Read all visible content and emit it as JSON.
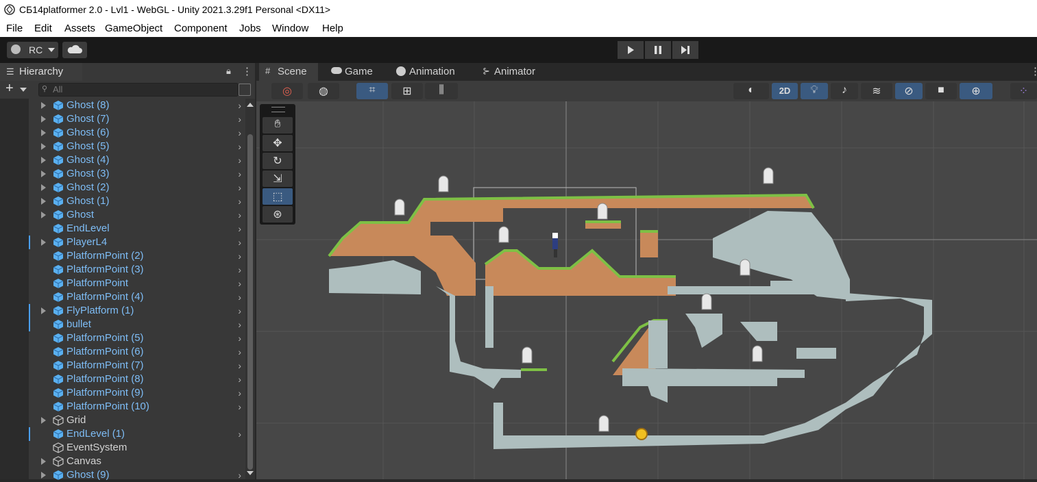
{
  "window": {
    "title": "СБ14platformer 2.0 - Lvl1 - WebGL - Unity 2021.3.29f1 Personal <DX11>"
  },
  "menu": [
    "File",
    "Edit",
    "Assets",
    "GameObject",
    "Component",
    "Jobs",
    "Window",
    "Help"
  ],
  "toolbar": {
    "account_label": "RC",
    "cloud_icon": "cloud-icon",
    "play_icon": "play-icon",
    "pause_icon": "pause-icon",
    "step_icon": "step-icon"
  },
  "hierarchy": {
    "tab_label": "Hierarchy",
    "search_placeholder": "All",
    "items": [
      {
        "label": "Ghost (8)",
        "type": "prefab",
        "expand": true,
        "marker": false
      },
      {
        "label": "Ghost (7)",
        "type": "prefab",
        "expand": true,
        "marker": false
      },
      {
        "label": "Ghost (6)",
        "type": "prefab",
        "expand": true,
        "marker": false
      },
      {
        "label": "Ghost (5)",
        "type": "prefab",
        "expand": true,
        "marker": false
      },
      {
        "label": "Ghost (4)",
        "type": "prefab",
        "expand": true,
        "marker": false
      },
      {
        "label": "Ghost (3)",
        "type": "prefab",
        "expand": true,
        "marker": false
      },
      {
        "label": "Ghost (2)",
        "type": "prefab",
        "expand": true,
        "marker": false
      },
      {
        "label": "Ghost (1)",
        "type": "prefab",
        "expand": true,
        "marker": false
      },
      {
        "label": "Ghost",
        "type": "prefab",
        "expand": true,
        "marker": false
      },
      {
        "label": "EndLevel",
        "type": "prefab",
        "expand": false,
        "marker": false
      },
      {
        "label": "PlayerL4",
        "type": "prefab",
        "expand": true,
        "marker": true
      },
      {
        "label": "PlatformPoint (2)",
        "type": "prefab",
        "expand": false,
        "marker": false
      },
      {
        "label": "PlatformPoint (3)",
        "type": "prefab",
        "expand": false,
        "marker": false
      },
      {
        "label": "PlatformPoint",
        "type": "prefab",
        "expand": false,
        "marker": false
      },
      {
        "label": "PlatformPoint (4)",
        "type": "prefab",
        "expand": false,
        "marker": false
      },
      {
        "label": "FlyPlatform (1)",
        "type": "prefab",
        "expand": true,
        "marker": true
      },
      {
        "label": "bullet",
        "type": "prefab",
        "expand": false,
        "marker": true
      },
      {
        "label": "PlatformPoint (5)",
        "type": "prefab",
        "expand": false,
        "marker": false
      },
      {
        "label": "PlatformPoint (6)",
        "type": "prefab",
        "expand": false,
        "marker": false
      },
      {
        "label": "PlatformPoint (7)",
        "type": "prefab",
        "expand": false,
        "marker": false
      },
      {
        "label": "PlatformPoint (8)",
        "type": "prefab",
        "expand": false,
        "marker": false
      },
      {
        "label": "PlatformPoint (9)",
        "type": "prefab",
        "expand": false,
        "marker": false
      },
      {
        "label": "PlatformPoint (10)",
        "type": "prefab",
        "expand": false,
        "marker": false
      },
      {
        "label": "Grid",
        "type": "plain",
        "expand": true,
        "marker": false
      },
      {
        "label": "EndLevel (1)",
        "type": "prefab",
        "expand": false,
        "marker": true
      },
      {
        "label": "EventSystem",
        "type": "plain",
        "expand": false,
        "marker": false
      },
      {
        "label": "Canvas",
        "type": "plain",
        "expand": true,
        "marker": false
      },
      {
        "label": "Ghost (9)",
        "type": "prefab",
        "expand": true,
        "marker": false
      }
    ]
  },
  "view_tabs": [
    {
      "label": "Scene",
      "icon": "grid-icon"
    },
    {
      "label": "Game",
      "icon": "gamepad-icon"
    },
    {
      "label": "Animation",
      "icon": "animation-icon"
    },
    {
      "label": "Animator",
      "icon": "animator-icon"
    }
  ],
  "scene_toolbar": {
    "mode_2d_label": "2D"
  },
  "colors": {
    "accent": "#3a5a80",
    "prefab_text": "#7ebdf6",
    "viewport_bg": "#474747",
    "dirt": "#c8895a",
    "grass": "#7ec045",
    "stone": "#aebebe"
  }
}
